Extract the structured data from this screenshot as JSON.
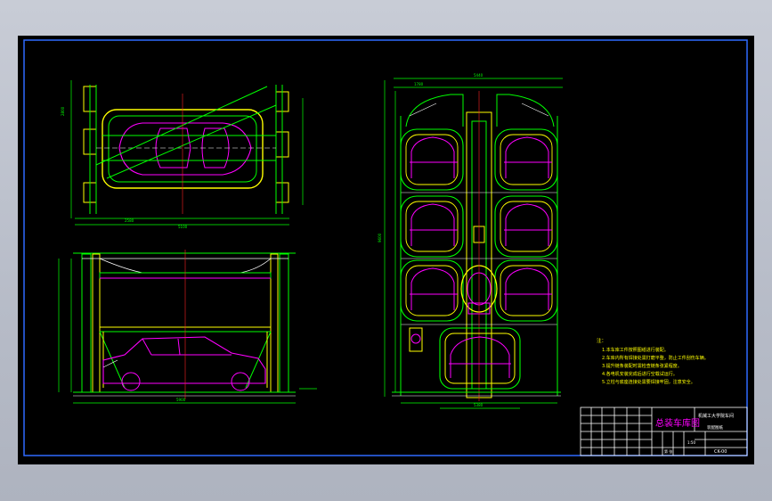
{
  "colors": {
    "background": "#000000",
    "border": "#2f6bff",
    "line_green": "#00ff00",
    "line_magenta": "#ff00ff",
    "line_yellow": "#ffff00",
    "line_white": "#ffffff",
    "line_cyan": "#00ffff",
    "line_red": "#ff2020",
    "desktop": "#c8ccd6"
  },
  "title_block": {
    "title": "总装车库图",
    "institution": "机械工大学院车间",
    "drawing_number": "CK-00",
    "scale": "1:50",
    "sheet_label": "第  张",
    "material_label": "装配图纸"
  },
  "notes": {
    "heading": "注：",
    "items": [
      "1.本车库工件按照图纸进行装配。",
      "2.车库内所有焊接处需打磨平整，防止工件刮伤车辆。",
      "3.提升链条装配时需检查链条张紧程度。",
      "4.各电机安装完成后进行空载试运行。",
      "5.立柱与底座连接处需要焊接牢固，注意安全。"
    ]
  },
  "dimensions": {
    "top_width": "5100",
    "top_left": "2580",
    "side_height": "2800",
    "bottom_width": "5900",
    "right_total_width": "5440",
    "right_inner_width": "1780",
    "right_height": "9600",
    "right_bottom": "5380"
  }
}
